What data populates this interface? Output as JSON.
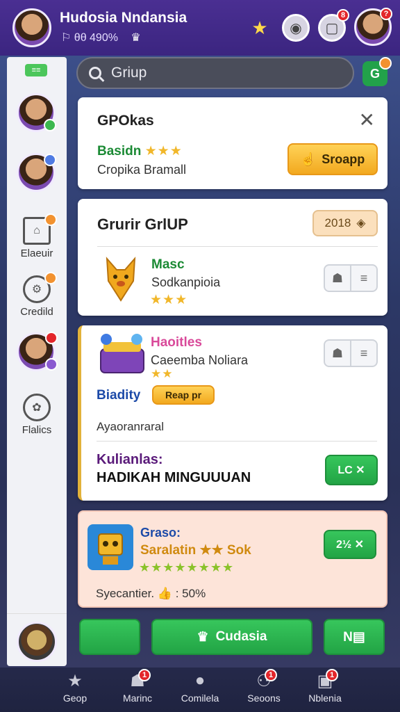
{
  "header": {
    "title": "Hudosia Nndansia",
    "subtitle": "⚐ θθ 490%",
    "subtitle_icon": "♛",
    "notification_count": "8",
    "avatar_badge": "?"
  },
  "search": {
    "placeholder": "Griup",
    "value": "Griup"
  },
  "sidebar": {
    "top_pill": "≡≡",
    "items": [
      {
        "label": "Elaeuir",
        "icon": "home-icon"
      },
      {
        "label": "Credild",
        "icon": "gear-icon"
      },
      {
        "label": "Flalics",
        "icon": "settings-icon"
      }
    ]
  },
  "card1": {
    "title": "GPOkas",
    "status": "Basidn",
    "rating": "★★★",
    "description": "Cropika Bramall",
    "button": "Sroapp"
  },
  "card2": {
    "title": "Grurir GrlUP",
    "badge": "2018",
    "item": {
      "name": "Masc",
      "description": "Sodkanpioia",
      "rating": "★★★"
    }
  },
  "card3": {
    "item": {
      "name": "Haoitles",
      "description": "Caeemba Noliara",
      "rating": "★★"
    },
    "tag_label": "Biadity",
    "tag_button": "Reap pr",
    "note": "Ayaoranraral",
    "section_label": "Kulianlas:",
    "section_value": "HADIKAH MINGUUUAN",
    "button": "LC ✕"
  },
  "card4": {
    "title": "Graso:",
    "subtitle": "Saralatin ★★ Sok",
    "rating": "★★★★★★★★",
    "footer": "Syecantier. 👍 : 50%",
    "button": "2½ ✕"
  },
  "actions": {
    "main_label": "Cudasia",
    "right_label": "N▤"
  },
  "nav": {
    "items": [
      {
        "label": "Geop",
        "badge": ""
      },
      {
        "label": "Marinc",
        "badge": "1"
      },
      {
        "label": "Comilela",
        "badge": ""
      },
      {
        "label": "Seoons",
        "badge": "1"
      },
      {
        "label": "Nblenia",
        "badge": "1"
      }
    ]
  },
  "colors": {
    "header": "#3b2580",
    "primary_green": "#22a445",
    "accent_orange": "#f2a91f",
    "star": "#f1b72a"
  }
}
